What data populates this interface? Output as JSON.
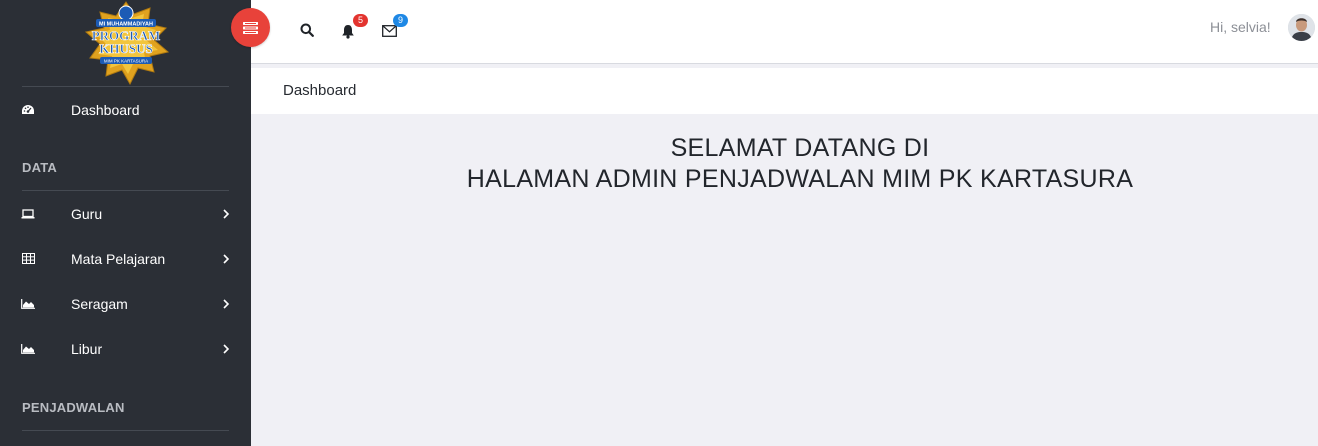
{
  "logo": {
    "text_top": "MI MUHAMMADIYAH",
    "text_main_1": "PROGRAM",
    "text_main_2": "KHUSUS",
    "text_bottom": "MIM PK KARTASURA"
  },
  "sidebar": {
    "items": [
      {
        "label": "Dashboard",
        "icon": "dashboard-icon"
      },
      {
        "label": "Guru",
        "icon": "laptop-icon"
      },
      {
        "label": "Mata Pelajaran",
        "icon": "table-icon"
      },
      {
        "label": "Seragam",
        "icon": "area-chart-icon"
      },
      {
        "label": "Libur",
        "icon": "area-chart-icon"
      }
    ],
    "headings": [
      "DATA",
      "PENJADWALAN"
    ]
  },
  "topbar": {
    "notifications_count": "5",
    "messages_count": "9",
    "greeting": "Hi, selvia!"
  },
  "page": {
    "title": "Dashboard",
    "welcome_line1": "SELAMAT DATANG DI",
    "welcome_line2": "HALAMAN ADMIN PENJADWALAN MIM PK KARTASURA"
  },
  "colors": {
    "sidebar_bg": "#2b2f36",
    "accent_red": "#e8423a",
    "badge_red": "#e3342f",
    "badge_blue": "#1e88e5",
    "content_bg": "#f0f0f5"
  }
}
